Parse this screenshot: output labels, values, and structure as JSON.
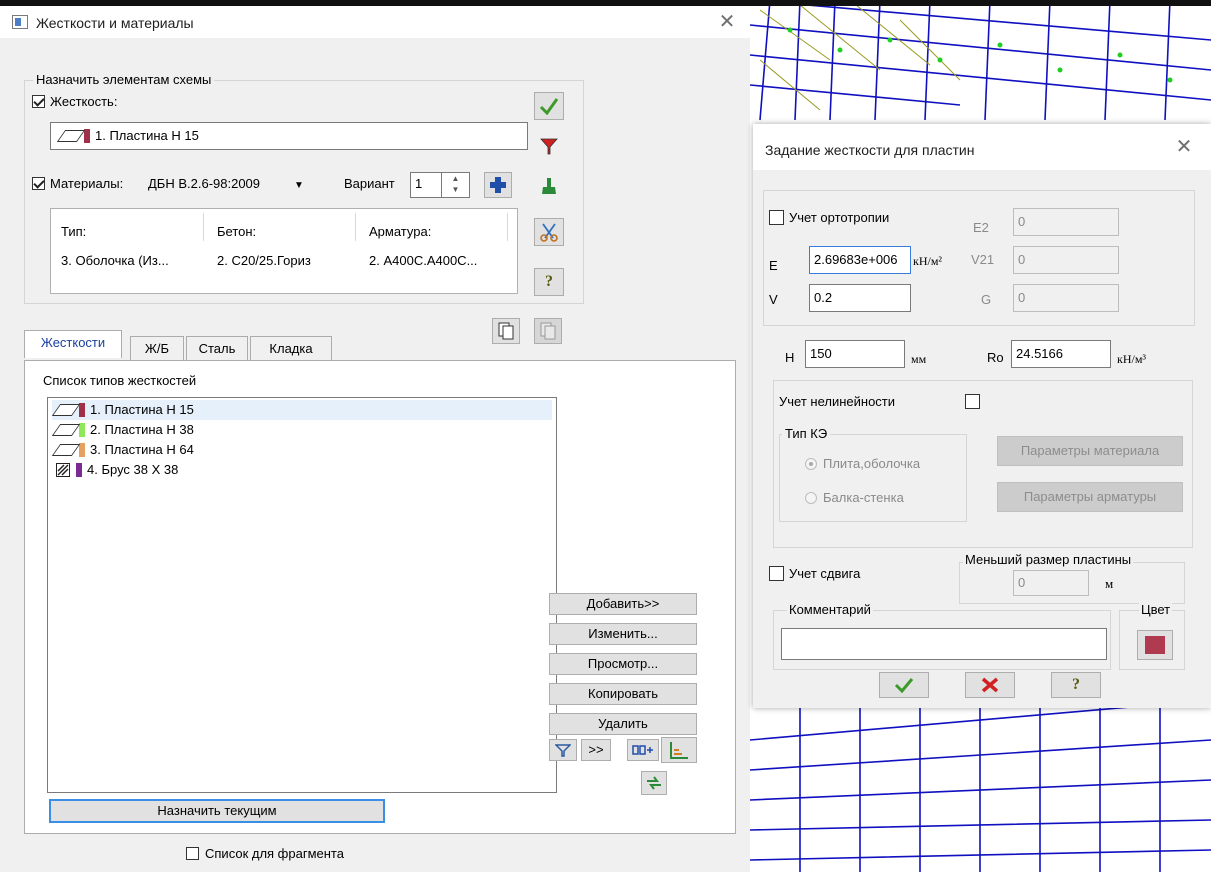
{
  "stiffness_window": {
    "title": "Жесткости и материалы",
    "assign_group_label": "Назначить элементам схемы",
    "stiffness_checkbox_label": "Жесткость:",
    "current_stiffness": "1. Пластина  Н 15",
    "materials_checkbox_label": "Материалы:",
    "materials_norm": "ДБН В.2.6-98:2009",
    "variant_label": "Вариант",
    "variant_value": "1",
    "materials_table": {
      "headers": [
        "Тип:",
        "Бетон:",
        "Арматура:"
      ],
      "row": [
        "3. Оболочка (Из...",
        "2. C20/25.Гориз",
        "2. А400С.А400С..."
      ]
    },
    "tabs": [
      "Жесткости",
      "Ж/Б",
      "Сталь",
      "Кладка"
    ],
    "list_label": "Список типов жесткостей",
    "list_items": [
      {
        "label": "1. Пластина  Н 15",
        "color": "#a0304a",
        "icon": "plate-icon"
      },
      {
        "label": "2. Пластина  Н 38",
        "color": "#8ee85a",
        "icon": "plate-icon"
      },
      {
        "label": "3. Пластина  Н 64",
        "color": "#e6a060",
        "icon": "plate-icon"
      },
      {
        "label": "4. Брус 38 X 38",
        "color": "#7a2a90",
        "icon": "beam-section-icon"
      }
    ],
    "buttons": {
      "add": "Добавить>>",
      "edit": "Изменить...",
      "view": "Просмотр...",
      "copy": "Копировать",
      "delete": "Удалить",
      "more": ">>",
      "assign_current": "Назначить текущим"
    },
    "fragment_checkbox_label": "Список для фрагмента"
  },
  "plate_dialog": {
    "title": "Задание жесткости для пластин",
    "orthotropy_label": "Учет ортотропии",
    "e_label": "E",
    "e_value": "2.69683e+006",
    "e_unit": "кН/м²",
    "v_label": "V",
    "v_value": "0.2",
    "e2_label": "E2",
    "e2_value": "0",
    "v21_label": "V21",
    "v21_value": "0",
    "g_label": "G",
    "g_value": "0",
    "h_label": "H",
    "h_value": "150",
    "h_unit": "мм",
    "ro_label": "Ro",
    "ro_value": "24.5166",
    "ro_unit": "кН/м³",
    "nonlinearity_label": "Учет нелинейности",
    "fe_type_label": "Тип КЭ",
    "fe_type_options": [
      "Плита,оболочка",
      "Балка-стенка"
    ],
    "material_params_button": "Параметры материала",
    "rebar_params_button": "Параметры арматуры",
    "shear_label": "Учет сдвига",
    "min_plate_size_label": "Меньший размер пластины",
    "min_plate_size_value": "0",
    "min_plate_size_unit": "м",
    "comment_label": "Комментарий",
    "comment_value": "",
    "color_label": "Цвет",
    "color_value": "#b03a50"
  }
}
